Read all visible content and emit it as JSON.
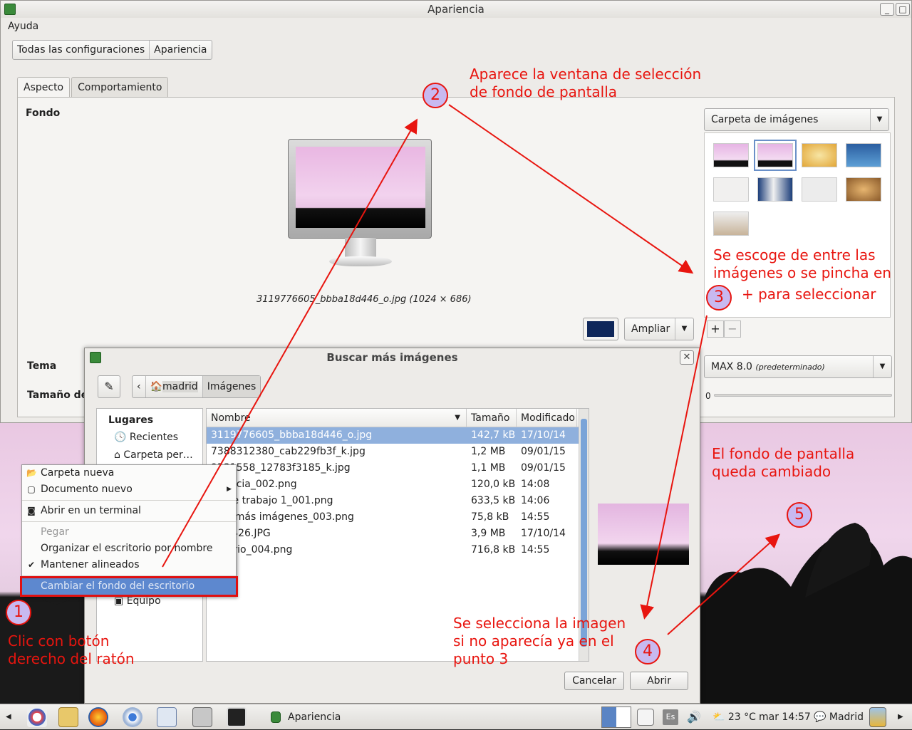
{
  "window": {
    "title": "Apariencia",
    "menu": "Ayuda"
  },
  "breadcrumb": [
    "Todas las configuraciones",
    "Apariencia"
  ],
  "tabs": [
    "Aspecto",
    "Comportamiento"
  ],
  "labels": {
    "fondo": "Fondo",
    "tema": "Tema",
    "tamano": "Tamaño de"
  },
  "wallpaper": {
    "caption": "3119776605_bbba18d446_o.jpg (1024 × 686)",
    "mode": "Ampliar",
    "folder": "Carpeta de imágenes",
    "color": "#0f275a"
  },
  "theme": {
    "name": "MAX 8.0",
    "note": "(predeterminado)"
  },
  "slider": {
    "value": "0"
  },
  "dialog": {
    "title": "Buscar más imágenes",
    "path": [
      "madrid",
      "Imágenes"
    ],
    "places_header": "Lugares",
    "places": [
      "Recientes",
      "Carpeta per…",
      "Equipo"
    ],
    "columns": [
      "Nombre",
      "Tamaño",
      "Modificado"
    ],
    "files": [
      {
        "name": "3119776605_bbba18d446_o.jpg",
        "size": "142,7 kB",
        "date": "17/10/14"
      },
      {
        "name": "7388312380_cab229fb3f_k.jpg",
        "size": "1,2 MB",
        "date": "09/01/15"
      },
      {
        "name": "9531558_12783f3185_k.jpg",
        "size": "1,1 MB",
        "date": "09/01/15"
      },
      {
        "name": "ariencia_002.png",
        "size": "120,0 kB",
        "date": "14:08"
      },
      {
        "name": "ea de trabajo 1_001.png",
        "size": "633,5 kB",
        "date": "14:06"
      },
      {
        "name": "scar más imágenes_003.png",
        "size": "75,8 kB",
        "date": "14:55"
      },
      {
        "name": "CN0426.JPG",
        "size": "3,9 MB",
        "date": "17/10/14"
      },
      {
        "name": "critorio_004.png",
        "size": "716,8 kB",
        "date": "14:55"
      }
    ],
    "cancel": "Cancelar",
    "open": "Abrir"
  },
  "context_menu": {
    "items": [
      "Carpeta nueva",
      "Documento nuevo",
      "Abrir en un terminal",
      "Pegar",
      "Organizar el escritorio por nombre",
      "Mantener alineados",
      "Cambiar el fondo del escritorio"
    ]
  },
  "taskbar": {
    "task": "Apariencia",
    "weather": "23 °C",
    "clock": "mar 14:57",
    "location": "Madrid",
    "lang": "Es"
  },
  "annotations": {
    "a1": "Clic con botón",
    "a1b": "derecho del ratón",
    "a2": "Aparece la ventana de selección",
    "a2b": "de fondo de pantalla",
    "a3": "Se escoge de entre las",
    "a3b": "imágenes o se pincha en",
    "a3c": "+ para seleccionar",
    "a4": "Se selecciona la imagen",
    "a4b": "si no aparecía ya en el",
    "a4c": "punto 3",
    "a5": "El fondo de pantalla",
    "a5b": "queda cambiado",
    "n1": "1",
    "n2": "2",
    "n3": "3",
    "n4": "4",
    "n5": "5"
  }
}
